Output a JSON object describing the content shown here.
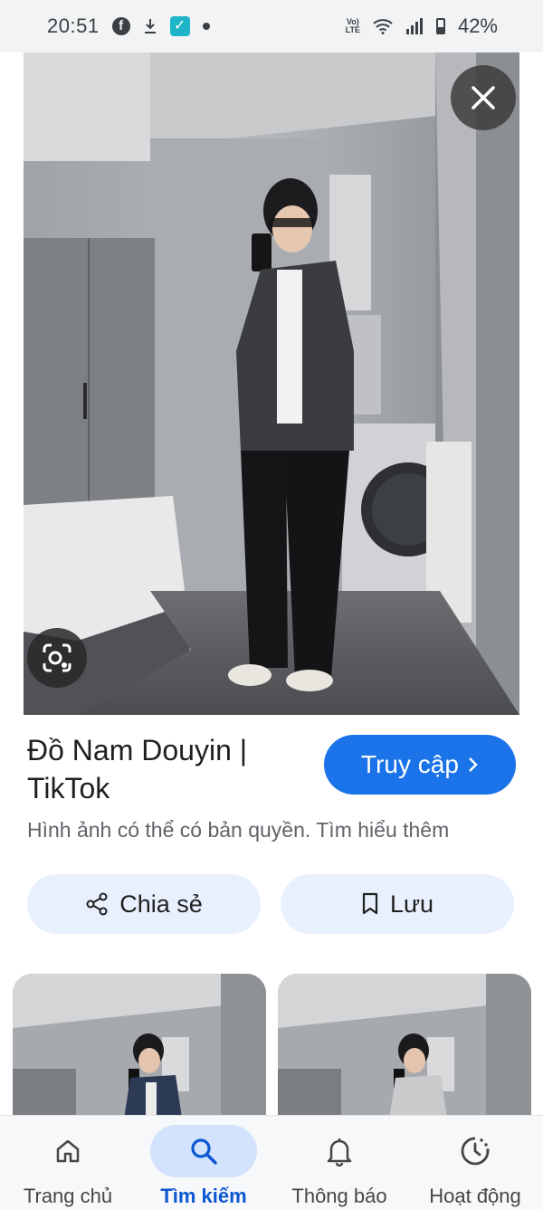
{
  "status_bar": {
    "time": "20:51",
    "left_icons": [
      "facebook-icon",
      "download-icon",
      "check-app-icon",
      "dot-icon"
    ],
    "volte": "VoLTE",
    "battery": "42%",
    "battery_level": 0.42
  },
  "viewer": {
    "close_icon": "close-icon",
    "lens_icon": "lens-icon"
  },
  "result": {
    "title": "Đồ Nam Douyin | TikTok",
    "visit_label": "Truy cập",
    "copyright_text": "Hình ảnh có thể có bản quyền. Tìm hiểu thêm"
  },
  "actions": {
    "share_label": "Chia sẻ",
    "save_label": "Lưu"
  },
  "bottom_nav": [
    {
      "label": "Trang chủ",
      "icon": "home-icon",
      "active": false
    },
    {
      "label": "Tìm kiếm",
      "icon": "search-icon",
      "active": true
    },
    {
      "label": "Thông báo",
      "icon": "bell-icon",
      "active": false
    },
    {
      "label": "Hoạt động",
      "icon": "activity-icon",
      "active": false
    }
  ],
  "colors": {
    "accent": "#1a73e8",
    "pill_bg": "#e8f0fe",
    "nav_active_bg": "#d3e3fd",
    "nav_active_text": "#0b57d0"
  }
}
